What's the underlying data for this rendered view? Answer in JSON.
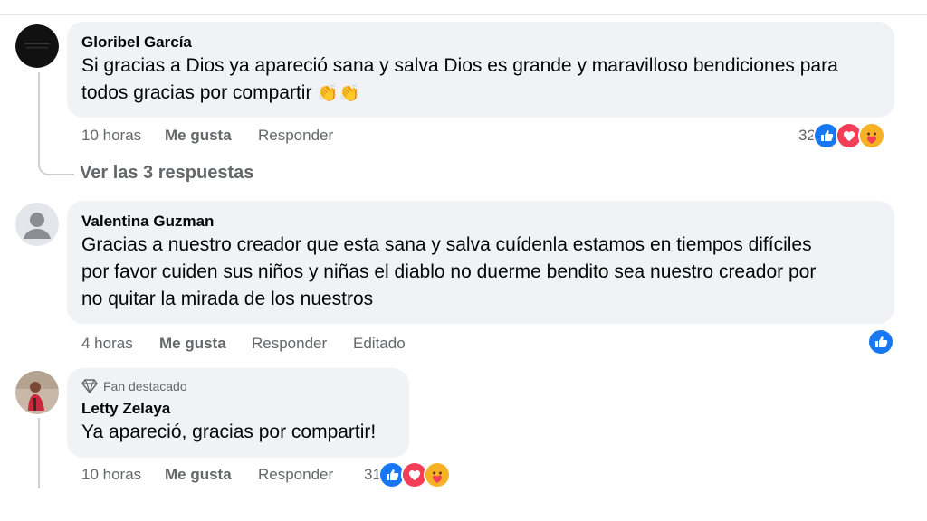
{
  "comments": [
    {
      "author": "Gloribel García",
      "text_lines": [
        "Si gracias a Dios ya apareció sana y salva Dios es grande y maravilloso bendiciones para",
        "todos gracias por compartir"
      ],
      "emoji": "👏👏",
      "time": "10 horas",
      "like_label": "Me gusta",
      "reply_label": "Responder",
      "reaction_count": "32",
      "reactions": [
        "like",
        "love",
        "care"
      ],
      "view_replies": "Ver las 3 respuestas"
    },
    {
      "author": "Valentina Guzman",
      "text_lines": [
        "Gracias a nuestro creador que esta sana y salva cuídenla estamos en tiempos difíciles",
        "por favor cuiden sus niños y niñas el diablo no duerme bendito sea nuestro creador por",
        "no quitar la mirada de los nuestros"
      ],
      "time": "4 horas",
      "like_label": "Me gusta",
      "reply_label": "Responder",
      "edited_label": "Editado",
      "reactions": [
        "like"
      ]
    },
    {
      "badge": "Fan destacado",
      "author": "Letty Zelaya",
      "text_lines": [
        "Ya apareció, gracias por compartir!"
      ],
      "time": "10 horas",
      "like_label": "Me gusta",
      "reply_label": "Responder",
      "reaction_count": "31",
      "reactions": [
        "like",
        "love",
        "care"
      ]
    }
  ],
  "colors": {
    "bubble": "#f0f2f5",
    "meta_text": "#65676b",
    "like_blue": "#1877f2",
    "love_red": "#f33e58",
    "care_yellow": "#f7b125"
  }
}
